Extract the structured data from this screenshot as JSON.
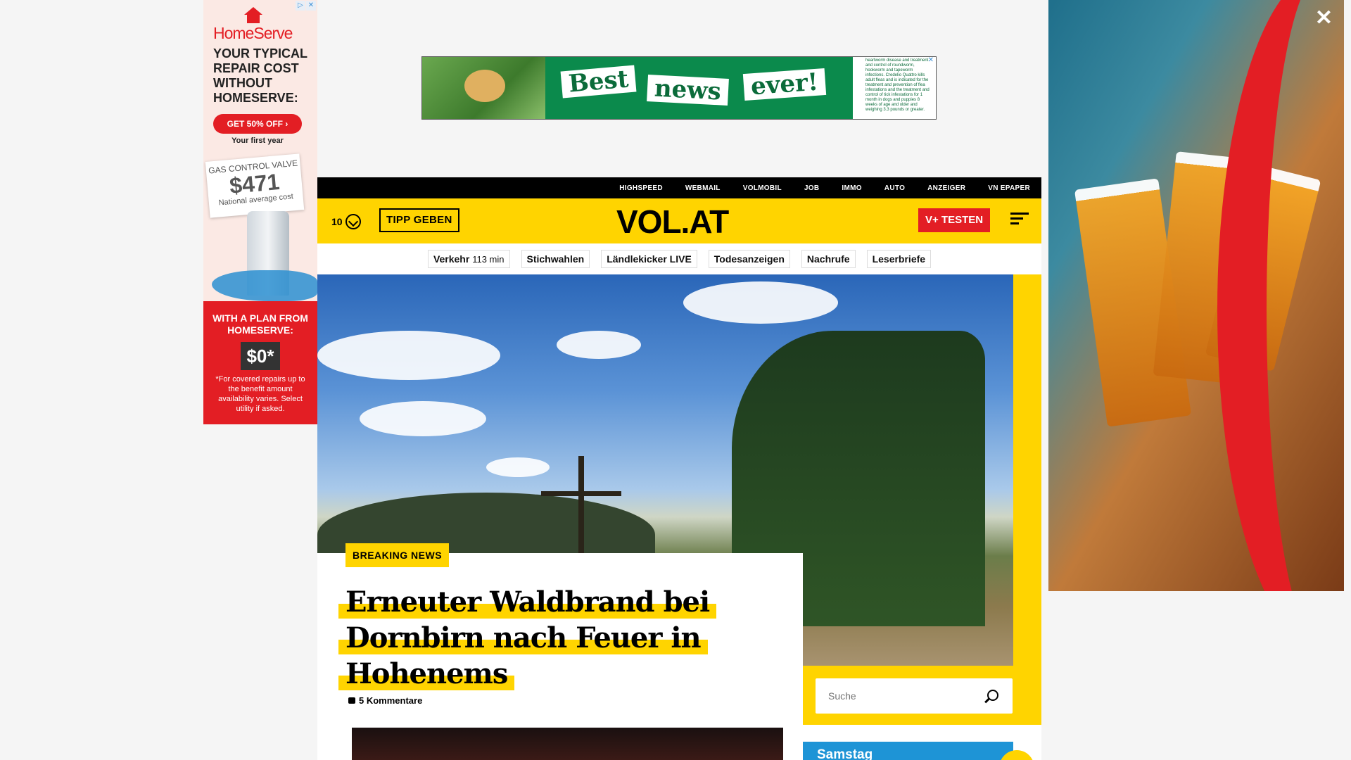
{
  "ad_left": {
    "choices": [
      "▷",
      "✕"
    ],
    "brand": "HomeServe",
    "headline": "YOUR TYPICAL REPAIR COST WITHOUT HOMESERVE:",
    "cta": "GET 50% OFF ›",
    "year_note": "Your first year",
    "card_label": "GAS CONTROL VALVE",
    "card_price": "$471",
    "card_sub": "National average cost",
    "plan_text": "WITH A PLAN FROM HOMESERVE:",
    "plan_price": "$0*",
    "disclaimer": "*For covered repairs up to the benefit amount availability varies. Select utility if asked."
  },
  "ad_top": {
    "words": [
      "Best",
      "news",
      "ever!"
    ],
    "side_text": "heartworm disease and treatment and control of roundworm, hookworm and tapeworm infections. Credelio Quattro kills adult fleas and is indicated for the treatment and prevention of flea infestations and the treatment and control of tick infestations for 1 month in dogs and puppies 8 weeks of age and older and weighing 3.3 pounds or greater."
  },
  "ad_right": {
    "close": "✕"
  },
  "topnav": [
    "HIGHSPEED",
    "WEBMAIL",
    "VOLMOBIL",
    "JOB",
    "IMMO",
    "AUTO",
    "ANZEIGER",
    "VN EPAPER"
  ],
  "header": {
    "counter": "10",
    "tipp": "TIPP GEBEN",
    "logo": "VOL.AT",
    "vplus": "V+ TESTEN"
  },
  "subnav": {
    "verkehr": "Verkehr",
    "verkehr_time": "113 min",
    "items": [
      "Stichwahlen",
      "Ländlekicker LIVE",
      "Todesanzeigen",
      "Nachrufe",
      "Leserbriefe"
    ]
  },
  "article": {
    "badge": "BREAKING NEWS",
    "title_lines": [
      "Erneuter Waldbrand bei",
      "Dornbirn nach Feuer in",
      "Hohenems"
    ],
    "comments": "5 Kommentare"
  },
  "search": {
    "placeholder": "Suche"
  },
  "weather": {
    "day": "Samstag"
  }
}
